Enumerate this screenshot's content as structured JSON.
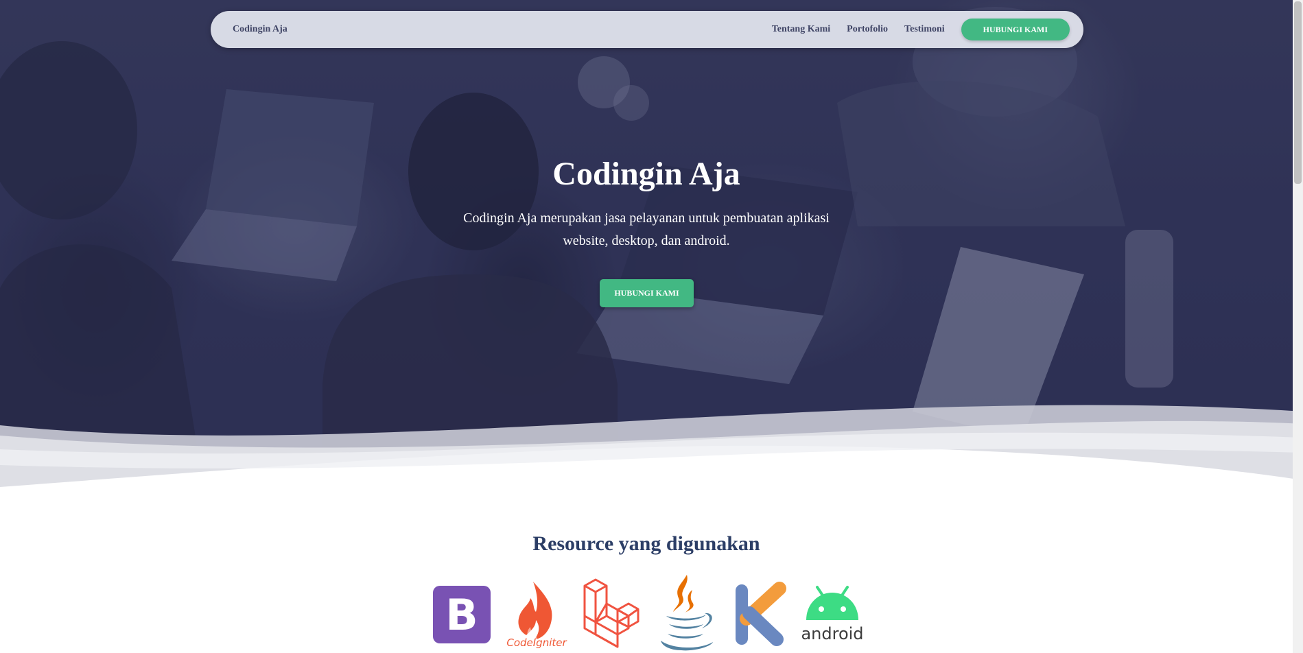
{
  "navbar": {
    "brand": "Codingin Aja",
    "links": [
      "Tentang Kami",
      "Portofolio",
      "Testimoni"
    ],
    "cta": "HUBUNGI KAMI"
  },
  "hero": {
    "title": "Codingin Aja",
    "description": "Codingin Aja merupakan jasa pelayanan untuk pembuatan aplikasi website, desktop, dan android.",
    "cta": "HUBUNGI KAMI"
  },
  "resources": {
    "title": "Resource yang digunakan",
    "logos": [
      {
        "name": "bootstrap-logo",
        "letter": "B",
        "color": "#7952b3"
      },
      {
        "name": "codeigniter-logo",
        "caption": "CodeIgniter",
        "color": "#ef5734"
      },
      {
        "name": "laravel-logo",
        "color": "#f05340"
      },
      {
        "name": "java-logo",
        "color": "#e76f00",
        "color2": "#5382a1"
      },
      {
        "name": "kotlin-logo",
        "color": "#f39c3c",
        "color2": "#6a88c0"
      },
      {
        "name": "android-logo",
        "caption": "android",
        "color": "#3ddc84"
      }
    ]
  },
  "colors": {
    "accent": "#42b883",
    "nav_text": "#3f4465",
    "heading": "#2c3e66",
    "hero_overlay": "#34375a"
  }
}
